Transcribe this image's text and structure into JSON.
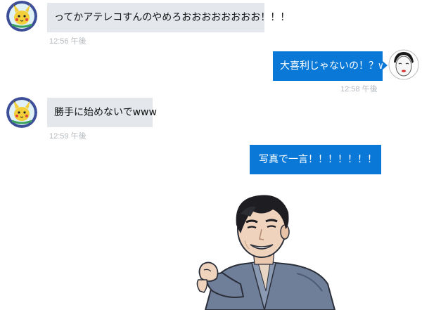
{
  "messages": [
    {
      "direction": "incoming",
      "avatar": "pikachu-avatar-icon",
      "text": "ってかアテレコすんのやめろおおおおおおおお！！！",
      "time": "12:56 午後"
    },
    {
      "direction": "outgoing",
      "avatar": "white-mask-avatar-icon",
      "text": "大喜利じゃないの！？w",
      "time": "12:58 午後"
    },
    {
      "direction": "incoming",
      "avatar": "pikachu-avatar-icon",
      "text": "勝手に始めないでwww",
      "time": "12:59 午後"
    },
    {
      "direction": "outgoing",
      "text": "写真で一言！！！！！！！"
    }
  ],
  "sticker": {
    "icon": "pointing-man-sticker",
    "description": "man in kimono pointing"
  },
  "colors": {
    "incoming_bubble": "#e4e8ed",
    "outgoing_bubble": "#0a78d7",
    "timestamp": "#b4b9be"
  }
}
